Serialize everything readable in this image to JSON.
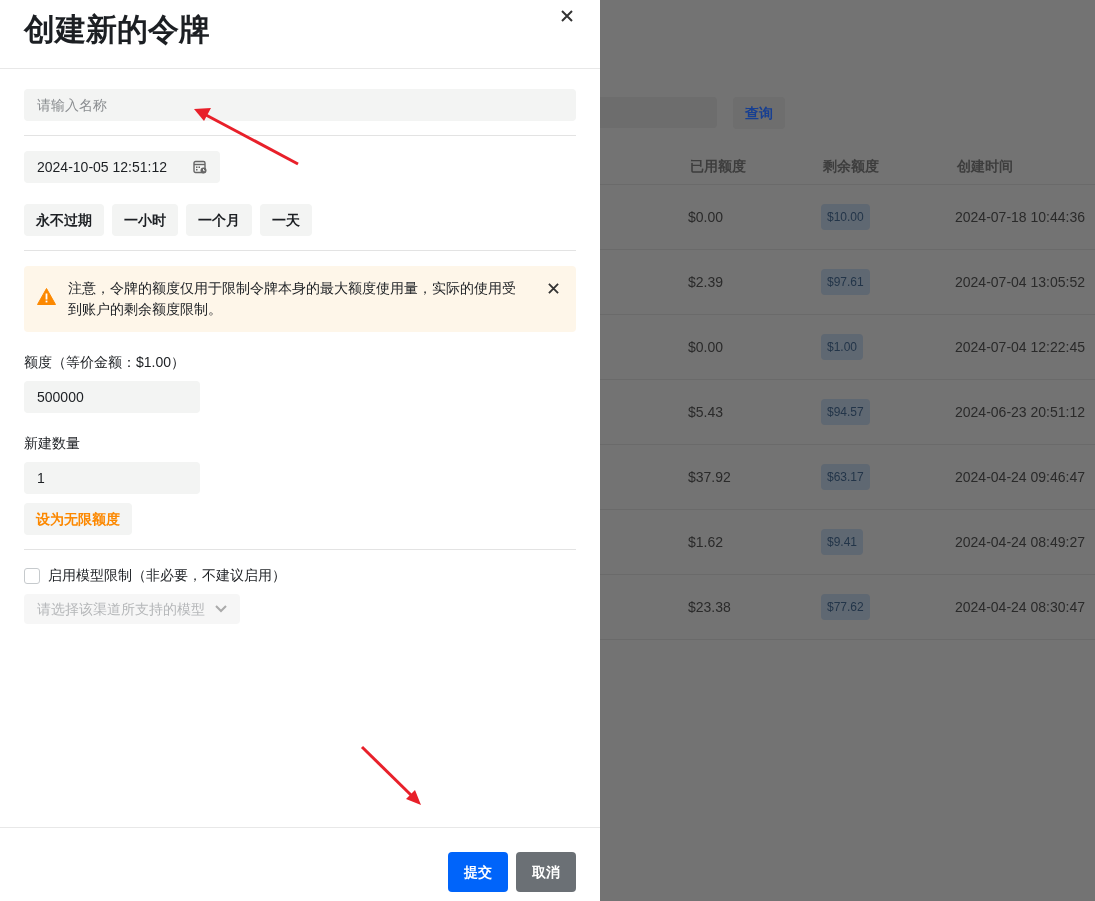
{
  "drawer": {
    "title": "创建新的令牌",
    "name_field": {
      "placeholder": "请输入名称"
    },
    "expiry_field": {
      "value": "2024-10-05 12:51:12"
    },
    "expiry_presets": [
      "永不过期",
      "一小时",
      "一个月",
      "一天"
    ],
    "notice": {
      "text": "注意，令牌的额度仅用于限制令牌本身的最大额度使用量，实际的使用受到账户的剩余额度限制。"
    },
    "quota": {
      "label": "额度（等价金额：$1.00）",
      "value": "500000"
    },
    "count": {
      "label": "新建数量",
      "value": "1"
    },
    "unlimited_button": "设为无限额度",
    "model_limit": {
      "label": "启用模型限制（非必要，不建议启用）",
      "checked": false
    },
    "model_select": {
      "placeholder": "请选择该渠道所支持的模型",
      "disabled": true
    },
    "buttons": [
      {
        "label": "提交",
        "kind": "primary"
      },
      {
        "label": "取消",
        "kind": "secondary"
      }
    ]
  },
  "background": {
    "query_button": "查询",
    "table": {
      "columns": [
        "已用额度",
        "剩余额度",
        "创建时间"
      ],
      "rows": [
        {
          "used": "$0.00",
          "remaining": "$10.00",
          "created": "2024-07-18 10:44:36"
        },
        {
          "used": "$2.39",
          "remaining": "$97.61",
          "created": "2024-07-04 13:05:52"
        },
        {
          "used": "$0.00",
          "remaining": "$1.00",
          "created": "2024-07-04 12:22:45"
        },
        {
          "used": "$5.43",
          "remaining": "$94.57",
          "created": "2024-06-23 20:51:12"
        },
        {
          "used": "$37.92",
          "remaining": "$63.17",
          "created": "2024-04-24 09:46:47"
        },
        {
          "used": "$1.62",
          "remaining": "$9.41",
          "created": "2024-04-24 08:49:27"
        },
        {
          "used": "$23.38",
          "remaining": "$77.62",
          "created": "2024-04-24 08:30:47"
        }
      ]
    }
  }
}
